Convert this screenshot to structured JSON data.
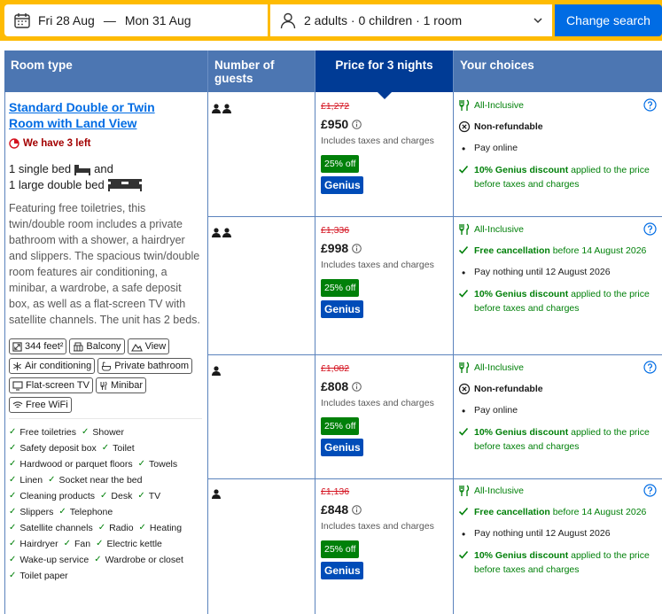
{
  "search": {
    "check_in": "Fri 28 Aug",
    "separator": "—",
    "check_out": "Mon 31 Aug",
    "guests_summary": "2 adults · 0 children · 1 room",
    "button_label": "Change search"
  },
  "table": {
    "headers": {
      "room_type": "Room type",
      "guests": "Number of guests",
      "price": "Price for 3 nights",
      "choices": "Your choices"
    }
  },
  "room": {
    "name": "Standard Double or Twin Room with Land View",
    "availability": "We have 3 left",
    "bed_single": "1 single bed",
    "bed_and": "and",
    "bed_double": "1 large double bed",
    "description": "Featuring free toiletries, this twin/double room includes a private bathroom with a shower, a hairdryer and slippers. The spacious twin/double room features air conditioning, a minibar, a wardrobe, a safe deposit box, as well as a flat-screen TV with satellite channels. The unit has 2 beds.",
    "tags": [
      "344 feet²",
      "Balcony",
      "View",
      "Air conditioning",
      "Private bathroom",
      "Flat-screen TV",
      "Minibar",
      "Free WiFi"
    ],
    "tag_icons": [
      "size-icon",
      "balcony-icon",
      "view-icon",
      "snowflake-icon",
      "bath-icon",
      "tv-icon",
      "minibar-icon",
      "wifi-icon"
    ],
    "facilities": [
      "Free toiletries",
      "Shower",
      "Safety deposit box",
      "Toilet",
      "Hardwood or parquet floors",
      "Towels",
      "Linen",
      "Socket near the bed",
      "Cleaning products",
      "Desk",
      "TV",
      "Slippers",
      "Telephone",
      "Satellite channels",
      "Radio",
      "Heating",
      "Hairdryer",
      "Fan",
      "Electric kettle",
      "Wake-up service",
      "Wardrobe or closet",
      "Toilet paper"
    ]
  },
  "rates": [
    {
      "guests": 2,
      "old_price": "£1,272",
      "price": "£950",
      "taxes": "Includes taxes and charges",
      "discount": "25% off",
      "genius": "Genius",
      "choices": [
        {
          "icon": "meal-icon",
          "parts": [
            {
              "t": "All-Inclusive",
              "c": "green"
            }
          ]
        },
        {
          "icon": "nonrefund-icon",
          "parts": [
            {
              "t": "Non-refundable",
              "c": "bold"
            }
          ]
        },
        {
          "icon": "bullet",
          "parts": [
            {
              "t": "Pay online",
              "c": ""
            }
          ]
        },
        {
          "icon": "check-icon",
          "parts": [
            {
              "t": "10% Genius discount",
              "c": "green bold"
            },
            {
              "t": " applied to the price before taxes and charges",
              "c": "green"
            }
          ]
        }
      ]
    },
    {
      "guests": 2,
      "old_price": "£1,336",
      "price": "£998",
      "taxes": "Includes taxes and charges",
      "discount": "25% off",
      "genius": "Genius",
      "choices": [
        {
          "icon": "meal-icon",
          "parts": [
            {
              "t": "All-Inclusive",
              "c": "green"
            }
          ]
        },
        {
          "icon": "check-icon",
          "parts": [
            {
              "t": "Free cancellation",
              "c": "green bold"
            },
            {
              "t": " before 14 August 2026",
              "c": "green"
            }
          ]
        },
        {
          "icon": "bullet",
          "parts": [
            {
              "t": "Pay nothing until 12 August 2026",
              "c": ""
            }
          ]
        },
        {
          "icon": "check-icon",
          "parts": [
            {
              "t": "10% Genius discount",
              "c": "green bold"
            },
            {
              "t": " applied to the price before taxes and charges",
              "c": "green"
            }
          ]
        }
      ]
    },
    {
      "guests": 1,
      "old_price": "£1,082",
      "price": "£808",
      "taxes": "Includes taxes and charges",
      "discount": "25% off",
      "genius": "Genius",
      "choices": [
        {
          "icon": "meal-icon",
          "parts": [
            {
              "t": "All-Inclusive",
              "c": "green"
            }
          ]
        },
        {
          "icon": "nonrefund-icon",
          "parts": [
            {
              "t": "Non-refundable",
              "c": "bold"
            }
          ]
        },
        {
          "icon": "bullet",
          "parts": [
            {
              "t": "Pay online",
              "c": ""
            }
          ]
        },
        {
          "icon": "check-icon",
          "parts": [
            {
              "t": "10% Genius discount",
              "c": "green bold"
            },
            {
              "t": " applied to the price before taxes and charges",
              "c": "green"
            }
          ]
        }
      ]
    },
    {
      "guests": 1,
      "old_price": "£1,136",
      "price": "£848",
      "taxes": "Includes taxes and charges",
      "discount": "25% off",
      "genius": "Genius",
      "choices": [
        {
          "icon": "meal-icon",
          "parts": [
            {
              "t": "All-Inclusive",
              "c": "green"
            }
          ]
        },
        {
          "icon": "check-icon",
          "parts": [
            {
              "t": "Free cancellation",
              "c": "green bold"
            },
            {
              "t": " before 14 August 2026",
              "c": "green"
            }
          ]
        },
        {
          "icon": "bullet",
          "parts": [
            {
              "t": "Pay nothing until 12 August 2026",
              "c": ""
            }
          ]
        },
        {
          "icon": "check-icon",
          "parts": [
            {
              "t": "10% Genius discount",
              "c": "green bold"
            },
            {
              "t": " applied to the price before taxes and charges",
              "c": "green"
            }
          ]
        }
      ]
    }
  ],
  "colors": {
    "search_bg": "#febb02",
    "button_blue": "#006ce4",
    "header_blue": "#4c76b2",
    "header_dark": "#003b95",
    "green": "#008009",
    "red": "#d4111e"
  }
}
